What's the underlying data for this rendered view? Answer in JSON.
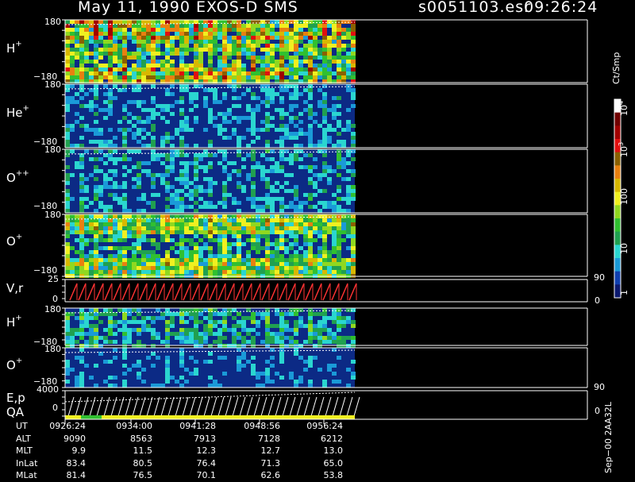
{
  "header": {
    "title": "May 11, 1990   EXOS-D SMS",
    "file": "s0051103.esr",
    "time": "09:26:24"
  },
  "colors": {
    "background": "#000000",
    "foreground": "#ffffff",
    "panel_fill": "#0c2a85",
    "vel_trace": "#ff3333",
    "scale": [
      "#0c1a70",
      "#1040b0",
      "#1a9ad8",
      "#2ad6d0",
      "#20a050",
      "#30c030",
      "#90d820",
      "#f0f020",
      "#d8b800",
      "#e88010",
      "#8a6000",
      "#e01010",
      "#a00000",
      "#700000",
      "#ffffff"
    ]
  },
  "colorbar": {
    "unit": "Ct/Smp",
    "ticks": [
      "1",
      "10",
      "100",
      "10",
      "10"
    ],
    "tick_exponents": [
      "",
      "",
      "",
      "3",
      "4"
    ]
  },
  "panels": [
    {
      "base": "H",
      "sup": "+",
      "top": "180",
      "bottom": "−180"
    },
    {
      "base": "He",
      "sup": "+",
      "top": "180",
      "bottom": "−180"
    },
    {
      "base": "O",
      "sup": "++",
      "top": "180",
      "bottom": "−180"
    },
    {
      "base": "O",
      "sup": "+",
      "top": "180",
      "bottom": "−180"
    },
    {
      "base": "V,r",
      "sup": "",
      "top": "25",
      "bottom": "0",
      "right_top": "90",
      "right_bottom": "0"
    },
    {
      "base": "H",
      "sup": "+",
      "top": "180",
      "bottom": "−180"
    },
    {
      "base": "O",
      "sup": "+",
      "top": "180",
      "bottom": "−180"
    },
    {
      "base": "E,p",
      "sup": "",
      "base2": "QA",
      "top": "4000",
      "bottom": "0",
      "right_top": "90",
      "right_bottom": "0"
    }
  ],
  "footer": {
    "row_labels": [
      "UT",
      "ALT",
      "MLT",
      "InLat",
      "MLat"
    ],
    "columns": [
      [
        "0926:24",
        "9090",
        "9.9",
        "83.4",
        "81.4"
      ],
      [
        "0934:00",
        "8563",
        "11.5",
        "80.5",
        "76.5"
      ],
      [
        "0941:28",
        "7913",
        "12.3",
        "76.4",
        "70.1"
      ],
      [
        "0948:56",
        "7128",
        "12.7",
        "71.3",
        "62.6"
      ],
      [
        "0956:24",
        "6212",
        "13.0",
        "65.0",
        "53.8"
      ]
    ],
    "version": "Sep−00 2AA32L"
  },
  "chart_data": {
    "type": "heatmap",
    "title": "May 11, 1990   EXOS-D SMS",
    "x_ticks": [
      "0926:24",
      "0934:00",
      "0941:28",
      "0948:56",
      "0956:24"
    ],
    "series": [
      {
        "name": "H+",
        "ylim": [
          -180,
          180
        ]
      },
      {
        "name": "He+",
        "ylim": [
          -180,
          180
        ]
      },
      {
        "name": "O++",
        "ylim": [
          -180,
          180
        ]
      },
      {
        "name": "O+",
        "ylim": [
          -180,
          180
        ]
      },
      {
        "name": "V,r",
        "ylim": [
          0,
          25
        ]
      },
      {
        "name": "H+",
        "ylim": [
          -180,
          180
        ]
      },
      {
        "name": "O+",
        "ylim": [
          -180,
          180
        ]
      },
      {
        "name": "E,p",
        "ylim": [
          0,
          4000
        ]
      }
    ],
    "colorbar_range": [
      "1",
      "10",
      "100",
      "10^3",
      "10^4"
    ],
    "colorbar_unit": "Ct/Smp"
  }
}
